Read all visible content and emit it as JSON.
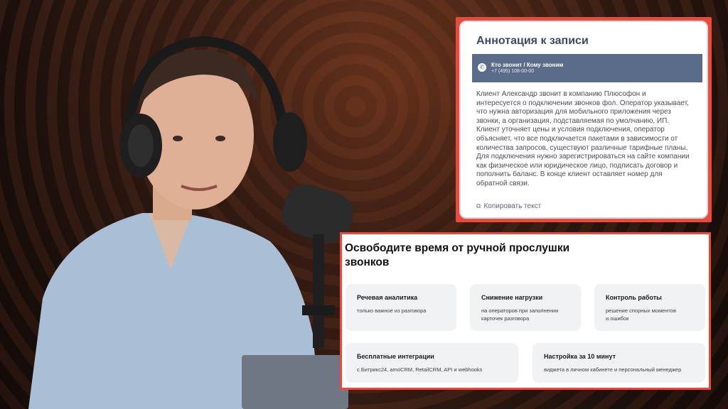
{
  "annotation": {
    "title": "Аннотация к записи",
    "caller_label": "Кто звонит / Кому звоним",
    "caller_phone": "+7 (495) 108-00-00",
    "text": "Клиент Александр звонит в компанию Плюсофон и интересуется о подключении звонков фол. Оператор указывает, что нужна авторизация для мобильного приложения через звонки, а организация, подставляемая по умолчанию, ИП. Клиент уточняет цены и условия подключения, оператор объясняет, что все подключается пакетами в зависимости от количества запросов, существуют различные тарифные планы. Для подключения нужно зарегистрироваться на сайте компании как физическое или юридическое лицо, подписать договор и пополнить баланс. В конце клиент оставляет номер для обратной связи.",
    "copy_label": "Копировать текст",
    "icons": {
      "phone": "phone-icon",
      "copy": "copy-icon"
    }
  },
  "features": {
    "title": "Освободите время от ручной прослушки звонков",
    "cards": [
      {
        "title": "Речевая аналитика",
        "desc": "только важное из разговора"
      },
      {
        "title": "Снижение нагрузки",
        "desc": "на операторов при заполнении карточек разговора"
      },
      {
        "title": "Контроль работы",
        "desc": "решение спорных моментов и ошибок"
      },
      {
        "title": "Бесплатные интеграции",
        "desc": "с Битрикс24, amoCRM, RetailCRM, API и webhooks"
      },
      {
        "title": "Настройка за 10 минут",
        "desc": "виджета в личном кабинете и персональный менеджер"
      }
    ]
  },
  "colors": {
    "frame_accent": "#e84b3a",
    "caller_bar": "#5b6b8a",
    "annotation_title": "#3b4a66",
    "card_bg": "#f1f2f4"
  }
}
